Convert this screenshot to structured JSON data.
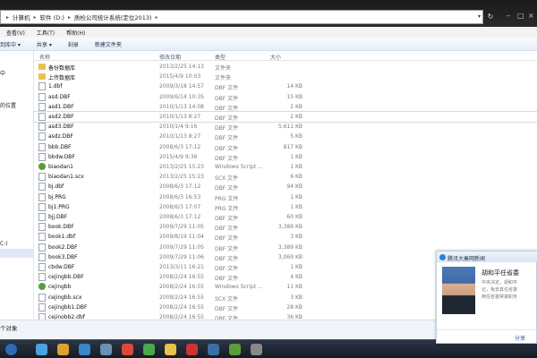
{
  "address": {
    "crumbs": [
      "计算机",
      "软件 (D:)",
      "质检公司统计系统(定位2013)"
    ]
  },
  "menu": [
    "查看(V)",
    "工具(T)",
    "帮助(H)"
  ],
  "toolbar": {
    "include_label": "到库中 ▾",
    "share_label": "共享 ▾",
    "burn_label": "刻录",
    "new_folder_label": "新建文件夹"
  },
  "nav": {
    "item1": "中",
    "item2": "的位置",
    "item3": "C:)"
  },
  "columns": {
    "name": "名称",
    "date": "修改日期",
    "type": "类型",
    "size": "大小"
  },
  "files": [
    {
      "name": "备份数据库",
      "date": "2013/2/25 14:13",
      "type": "文件夹",
      "size": "",
      "icon": "folder"
    },
    {
      "name": "上传数据库",
      "date": "2015/4/9 10:03",
      "type": "文件夹",
      "size": "",
      "icon": "folder"
    },
    {
      "name": "1.dbf",
      "date": "2009/3/18 14:57",
      "type": "DBF 文件",
      "size": "14 KB",
      "icon": "doc"
    },
    {
      "name": "asd.DBF",
      "date": "2009/6/14 10:35",
      "type": "DBF 文件",
      "size": "15 KB",
      "icon": "doc"
    },
    {
      "name": "asd1.DBF",
      "date": "2010/1/13 14:08",
      "type": "DBF 文件",
      "size": "2 KB",
      "icon": "doc"
    },
    {
      "name": "asd2.DBF",
      "date": "2010/1/13 8:27",
      "type": "DBF 文件",
      "size": "2 KB",
      "icon": "doc"
    },
    {
      "name": "asd3.DBF",
      "date": "2010/1/4 9:16",
      "type": "DBF 文件",
      "size": "5,611 KB",
      "icon": "doc"
    },
    {
      "name": "asdz.DBF",
      "date": "2010/1/13 8:27",
      "type": "DBF 文件",
      "size": "5 KB",
      "icon": "doc"
    },
    {
      "name": "bbb.DBF",
      "date": "2008/6/3 17:12",
      "type": "DBF 文件",
      "size": "817 KB",
      "icon": "doc"
    },
    {
      "name": "bbdw.DBF",
      "date": "2015/4/9 9:36",
      "type": "DBF 文件",
      "size": "1 KB",
      "icon": "doc"
    },
    {
      "name": "biaodan1",
      "date": "2013/2/25 15:23",
      "type": "Windows Script ...",
      "size": "1 KB",
      "icon": "script"
    },
    {
      "name": "biaodan1.scx",
      "date": "2013/2/25 15:23",
      "type": "SCX 文件",
      "size": "6 KB",
      "icon": "doc"
    },
    {
      "name": "bj.dbf",
      "date": "2008/6/3 17:12",
      "type": "DBF 文件",
      "size": "94 KB",
      "icon": "doc"
    },
    {
      "name": "bj.PRG",
      "date": "2008/6/3 16:53",
      "type": "PRG 文件",
      "size": "1 KB",
      "icon": "doc"
    },
    {
      "name": "bj1.PRG",
      "date": "2008/6/3 17:07",
      "type": "PRG 文件",
      "size": "1 KB",
      "icon": "doc"
    },
    {
      "name": "bjj.DBF",
      "date": "2008/6/3 17:12",
      "type": "DBF 文件",
      "size": "60 KB",
      "icon": "doc"
    },
    {
      "name": "book.DBF",
      "date": "2009/7/29 11:05",
      "type": "DBF 文件",
      "size": "3,389 KB",
      "icon": "doc"
    },
    {
      "name": "book1.dbf",
      "date": "2009/8/19 11:04",
      "type": "DBF 文件",
      "size": "3 KB",
      "icon": "doc"
    },
    {
      "name": "book2.DBF",
      "date": "2009/7/29 11:05",
      "type": "DBF 文件",
      "size": "3,389 KB",
      "icon": "doc"
    },
    {
      "name": "book3.DBF",
      "date": "2009/7/29 11:06",
      "type": "DBF 文件",
      "size": "3,069 KB",
      "icon": "doc"
    },
    {
      "name": "cbdw.DBF",
      "date": "2013/3/11 16:21",
      "type": "DBF 文件",
      "size": "1 KB",
      "icon": "doc"
    },
    {
      "name": "cejingbb.DBF",
      "date": "2008/2/24 16:55",
      "type": "DBF 文件",
      "size": "4 KB",
      "icon": "doc"
    },
    {
      "name": "cejingbb",
      "date": "2008/2/24 16:55",
      "type": "Windows Script ...",
      "size": "11 KB",
      "icon": "script"
    },
    {
      "name": "cejingbb.scx",
      "date": "2008/2/24 16:55",
      "type": "SCX 文件",
      "size": "3 KB",
      "icon": "doc"
    },
    {
      "name": "cejingbb1.DBF",
      "date": "2008/2/24 16:55",
      "type": "DBF 文件",
      "size": "28 KB",
      "icon": "doc"
    },
    {
      "name": "cejinobb2.dbf",
      "date": "2008/2/24 16:55",
      "type": "DBF 文件",
      "size": "36 KB",
      "icon": "doc"
    }
  ],
  "status": {
    "text": "个对象"
  },
  "popup": {
    "title": "腾讯大秦网新闻",
    "headline": "胡和平任省委",
    "body": [
      "中央决定，胡和平",
      "记，免去其任省委",
      "两任省委常委职务"
    ],
    "share": "分享"
  },
  "colors": {
    "selected_border": "#cfdbe8",
    "folder": "#e8c24a",
    "taskbar": "#1b2430"
  }
}
